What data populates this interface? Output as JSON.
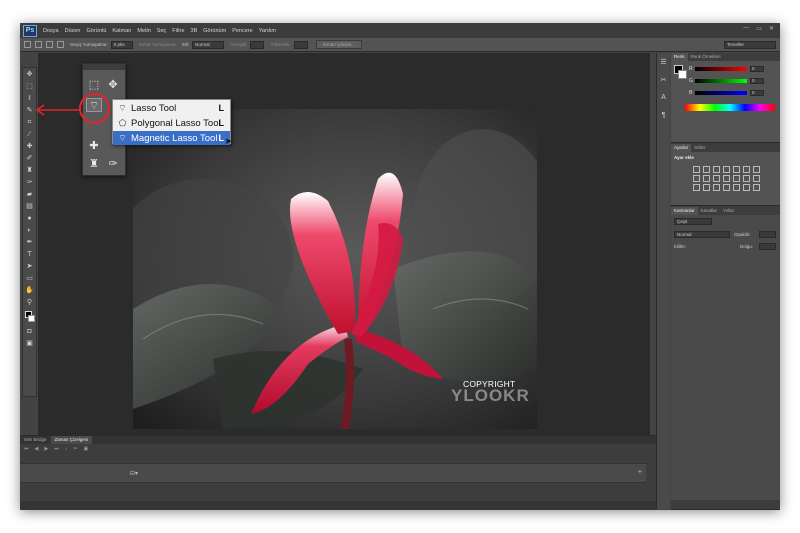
{
  "app": {
    "logo": "Ps"
  },
  "menu": [
    "Dosya",
    "Düzen",
    "Görüntü",
    "Katman",
    "Metin",
    "Seç",
    "Filtre",
    "3B",
    "Görünüm",
    "Pencere",
    "Yardım"
  ],
  "window_controls": [
    "—",
    "▭",
    "✕"
  ],
  "options_bar": {
    "feather_label": "Geçiş Yumuşatma:",
    "feather_value": "0 pks",
    "antialias_label": "Kenar Yumuşatma",
    "style_label": "Stil:",
    "style_value": "Normal",
    "width_label": "Genişlik:",
    "height_label": "Yükseklik:",
    "refine_button": "Kenarı İyileştir...",
    "workspace": "Temeller"
  },
  "lasso_menu": {
    "items": [
      {
        "label": "Lasso Tool",
        "key": "L",
        "icon": "lasso-icon"
      },
      {
        "label": "Polygonal Lasso Tool",
        "key": "L",
        "icon": "polygonal-lasso-icon"
      },
      {
        "label": "Magnetic Lasso Tool",
        "key": "L",
        "icon": "magnetic-lasso-icon",
        "selected": true
      }
    ]
  },
  "photo": {
    "copyright": "COPYRIGHT",
    "watermark": "YLOOKR"
  },
  "right_panels": {
    "color_tabs": [
      "Renk",
      "Renk Örnekleri"
    ],
    "color_rows": [
      {
        "label": "R",
        "value": "0"
      },
      {
        "label": "G",
        "value": "0"
      },
      {
        "label": "B",
        "value": "0"
      }
    ],
    "adjust_tabs": [
      "Ayarlar",
      "Stiller"
    ],
    "adjust_title": "Ayar ekle",
    "layers_tabs": [
      "Katmanlar",
      "Kanallar",
      "Yollar"
    ],
    "layers_kind": "Çeşit",
    "layers_blend": "Normal",
    "layers_opacity_label": "Opaklık:",
    "layers_lock_label": "Kilitle:",
    "layers_fill_label": "Dolgu:"
  },
  "timeline": {
    "tabs": [
      "Mini Bridge",
      "Zaman Çizelgesi"
    ]
  },
  "colors": {
    "annotation_red": "#e3242b",
    "selection_blue": "#3a6fc8",
    "flower_red": "#d1143a"
  }
}
